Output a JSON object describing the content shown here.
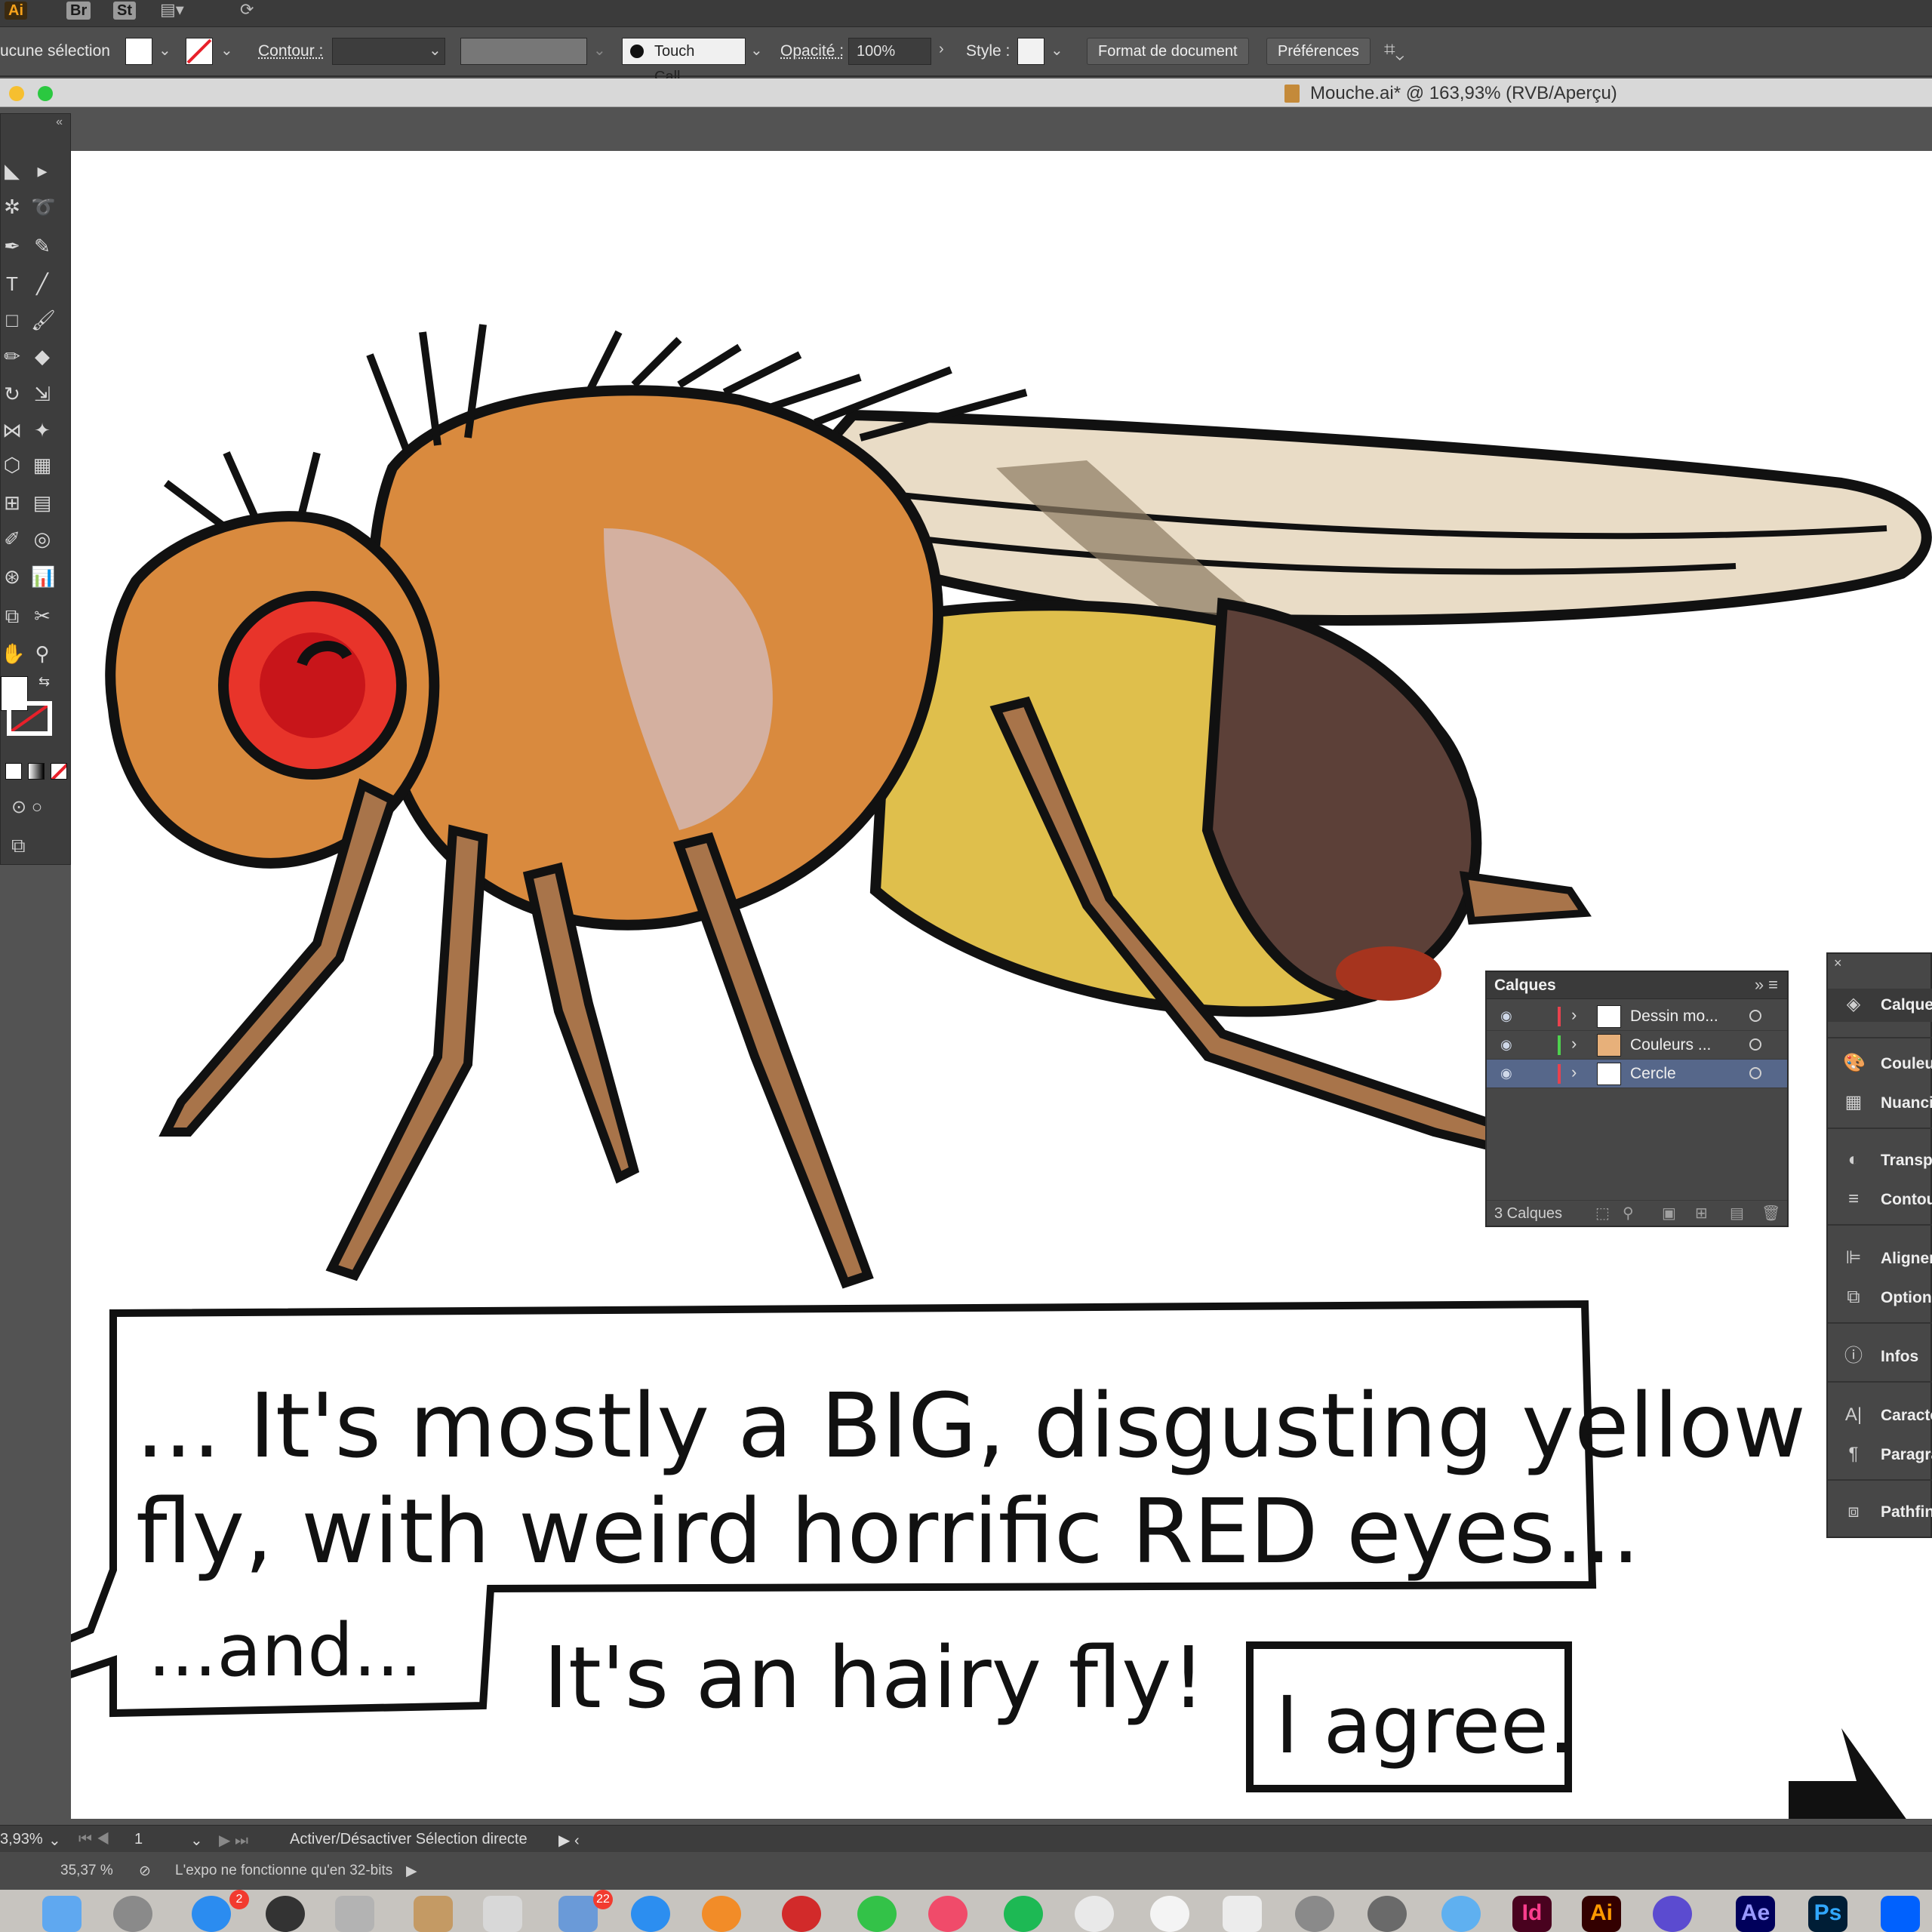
{
  "app": {
    "app_tags": [
      "Ai",
      "Br",
      "St"
    ]
  },
  "control_bar": {
    "selection_label": "ucune sélection",
    "stroke_label": "Contour :",
    "brush_name": "Touch Call...",
    "opacity_label": "Opacité :",
    "opacity_value": "100%",
    "style_label": "Style :",
    "document_setup_button": "Format de document",
    "preferences_button": "Préférences"
  },
  "document": {
    "title": "Mouche.ai* @ 163,93% (RVB/Aperçu)"
  },
  "comic": {
    "line1": "... It's mostly a BIG, disgusting yellow",
    "line2": "fly, with weird horrific RED eyes...",
    "aside": "...and...",
    "shout": "It's an hairy fly!",
    "reply": "I agree."
  },
  "layers_panel": {
    "tab_label": "Calques",
    "layers": [
      {
        "name": "Dessin mo...",
        "color": "#e8424e",
        "selected": false
      },
      {
        "name": "Couleurs ...",
        "color": "#4ed14e",
        "selected": false
      },
      {
        "name": "Cercle",
        "color": "#e8424e",
        "selected": true
      }
    ],
    "count_label": "3 Calques"
  },
  "dock_panels": [
    {
      "label": "Calques",
      "icon": "layers-icon"
    },
    {
      "label": "Couleu",
      "icon": "palette-icon"
    },
    {
      "label": "Nuanci",
      "icon": "swatches-icon"
    },
    {
      "label": "Transp",
      "icon": "transparency-icon"
    },
    {
      "label": "Contou",
      "icon": "stroke-icon"
    },
    {
      "label": "Aligner",
      "icon": "align-icon"
    },
    {
      "label": "Option",
      "icon": "options-icon"
    },
    {
      "label": "Infos",
      "icon": "info-icon"
    },
    {
      "label": "Caractè",
      "icon": "character-icon"
    },
    {
      "label": "Paragra",
      "icon": "paragraph-icon"
    },
    {
      "label": "Pathfin",
      "icon": "pathfinder-icon"
    }
  ],
  "status_bar": {
    "zoom": "3,93%",
    "artboard_number": "1",
    "tool_hint": "Activer/Désactiver Sélection directe",
    "zoom2": "35,37 %",
    "export_message": "L'expo ne fonctionne qu'en 32-bits"
  },
  "macos_dock": {
    "badges": [
      "2",
      "22"
    ],
    "apps": [
      "Id",
      "Ai",
      "Ae",
      "Ps"
    ]
  },
  "colors": {
    "fly_orange": "#d98a3e",
    "fly_eye": "#e8342a",
    "fly_wing": "#e9dcc6",
    "fly_abdomen_yellow": "#dfbf4c",
    "fly_abdomen_brown": "#5c4038",
    "fly_leg": "#a8744a"
  }
}
